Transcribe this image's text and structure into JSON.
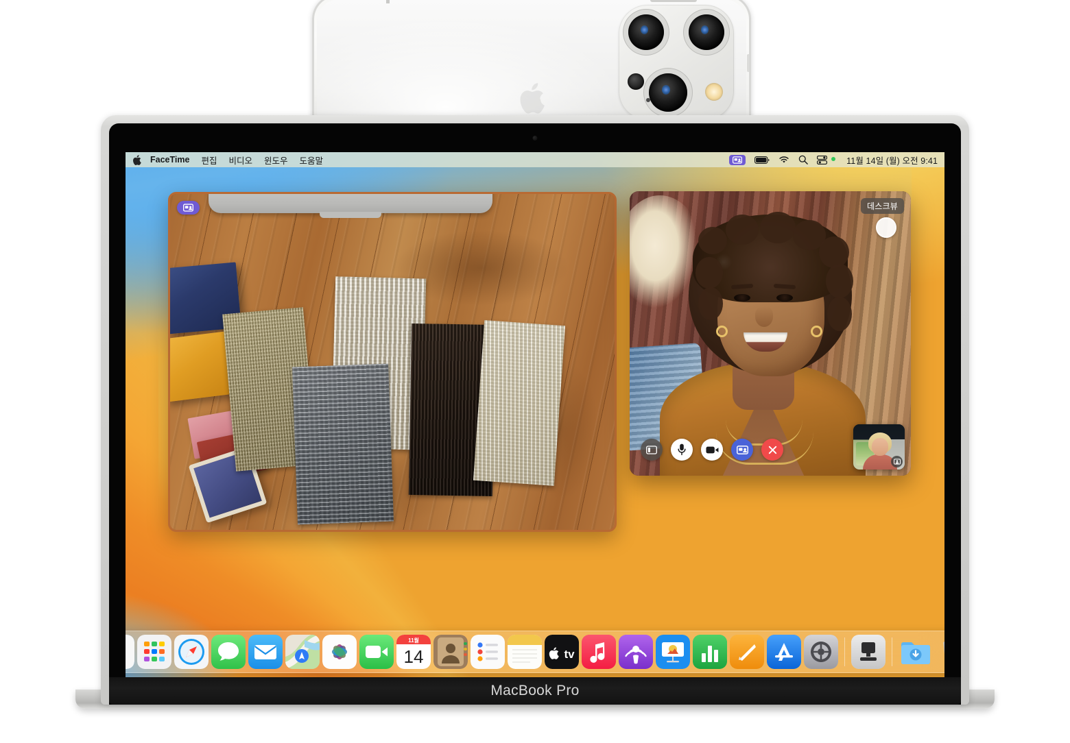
{
  "device": {
    "laptop_label": "MacBook Pro",
    "phone_name": "iphone-continuity-camera"
  },
  "menubar": {
    "apple_icon": "apple-logo-icon",
    "items": [
      {
        "label": "FaceTime",
        "bold": true
      },
      {
        "label": "편집",
        "bold": false
      },
      {
        "label": "비디오",
        "bold": false
      },
      {
        "label": "윈도우",
        "bold": false
      },
      {
        "label": "도움말",
        "bold": false
      }
    ],
    "status": {
      "screen_share_icon": "screen-share-icon",
      "battery_icon": "battery-icon",
      "wifi_icon": "wifi-icon",
      "search_icon": "search-icon",
      "control_center_icon": "control-center-icon",
      "recording_dot": "green-recording-dot",
      "clock": "11월 14일 (월) 오전 9:41"
    }
  },
  "desk_view": {
    "window_name": "desk-view-window",
    "badge_icon": "screen-share-icon",
    "content_description": "fabric-swatches-on-wooden-desk"
  },
  "facetime": {
    "window_name": "facetime-call-window",
    "desk_view_badge": "데스크뷰",
    "capture_button": "capture-button",
    "controls": [
      {
        "name": "sidebar-toggle-button",
        "icon": "sidebar-icon",
        "style": "dark"
      },
      {
        "name": "microphone-button",
        "icon": "microphone-icon",
        "style": "white"
      },
      {
        "name": "camera-button",
        "icon": "video-camera-icon",
        "style": "white"
      },
      {
        "name": "share-screen-button",
        "icon": "screen-share-icon",
        "style": "blue"
      },
      {
        "name": "end-call-button",
        "icon": "close-x-icon",
        "style": "red"
      }
    ],
    "pip": {
      "name": "self-view-pip",
      "badge_icon": "effects-portrait-icon"
    }
  },
  "dock": {
    "items": [
      {
        "name": "dock-item-finder",
        "label": "Finder",
        "running": true
      },
      {
        "name": "dock-item-launchpad",
        "label": "Launchpad",
        "running": false
      },
      {
        "name": "dock-item-safari",
        "label": "Safari",
        "running": false
      },
      {
        "name": "dock-item-messages",
        "label": "메시지",
        "running": false
      },
      {
        "name": "dock-item-mail",
        "label": "Mail",
        "running": false
      },
      {
        "name": "dock-item-maps",
        "label": "지도",
        "running": false
      },
      {
        "name": "dock-item-photos",
        "label": "사진",
        "running": false
      },
      {
        "name": "dock-item-facetime",
        "label": "FaceTime",
        "running": true
      },
      {
        "name": "dock-item-calendar",
        "label": "캘린더",
        "running": false,
        "month": "11월",
        "day": "14"
      },
      {
        "name": "dock-item-contacts",
        "label": "연락처",
        "running": false
      },
      {
        "name": "dock-item-reminders",
        "label": "미리 알림",
        "running": false
      },
      {
        "name": "dock-item-notes",
        "label": "메모",
        "running": false
      },
      {
        "name": "dock-item-appletv",
        "label": "Apple TV",
        "running": false
      },
      {
        "name": "dock-item-music",
        "label": "음악",
        "running": false
      },
      {
        "name": "dock-item-podcasts",
        "label": "팟캐스트",
        "running": false
      },
      {
        "name": "dock-item-keynote",
        "label": "Keynote",
        "running": false
      },
      {
        "name": "dock-item-numbers",
        "label": "Numbers",
        "running": false
      },
      {
        "name": "dock-item-pages",
        "label": "Pages",
        "running": false
      },
      {
        "name": "dock-item-appstore",
        "label": "App Store",
        "running": false
      },
      {
        "name": "dock-item-system-settings",
        "label": "시스템 설정",
        "running": false
      },
      {
        "name": "dock-item-screen-sharing",
        "label": "화면 공유",
        "running": true
      },
      {
        "name": "dock-item-downloads",
        "label": "다운로드",
        "running": false
      },
      {
        "name": "dock-item-trash",
        "label": "휴지통",
        "running": false
      }
    ]
  },
  "colors": {
    "accent_purple": "#6f5bd4",
    "accent_blue": "#4a63d8",
    "end_call_red": "#f04a4a",
    "desk_view_border": "#b86a33",
    "menubar_bg": "#e2e6d2"
  }
}
